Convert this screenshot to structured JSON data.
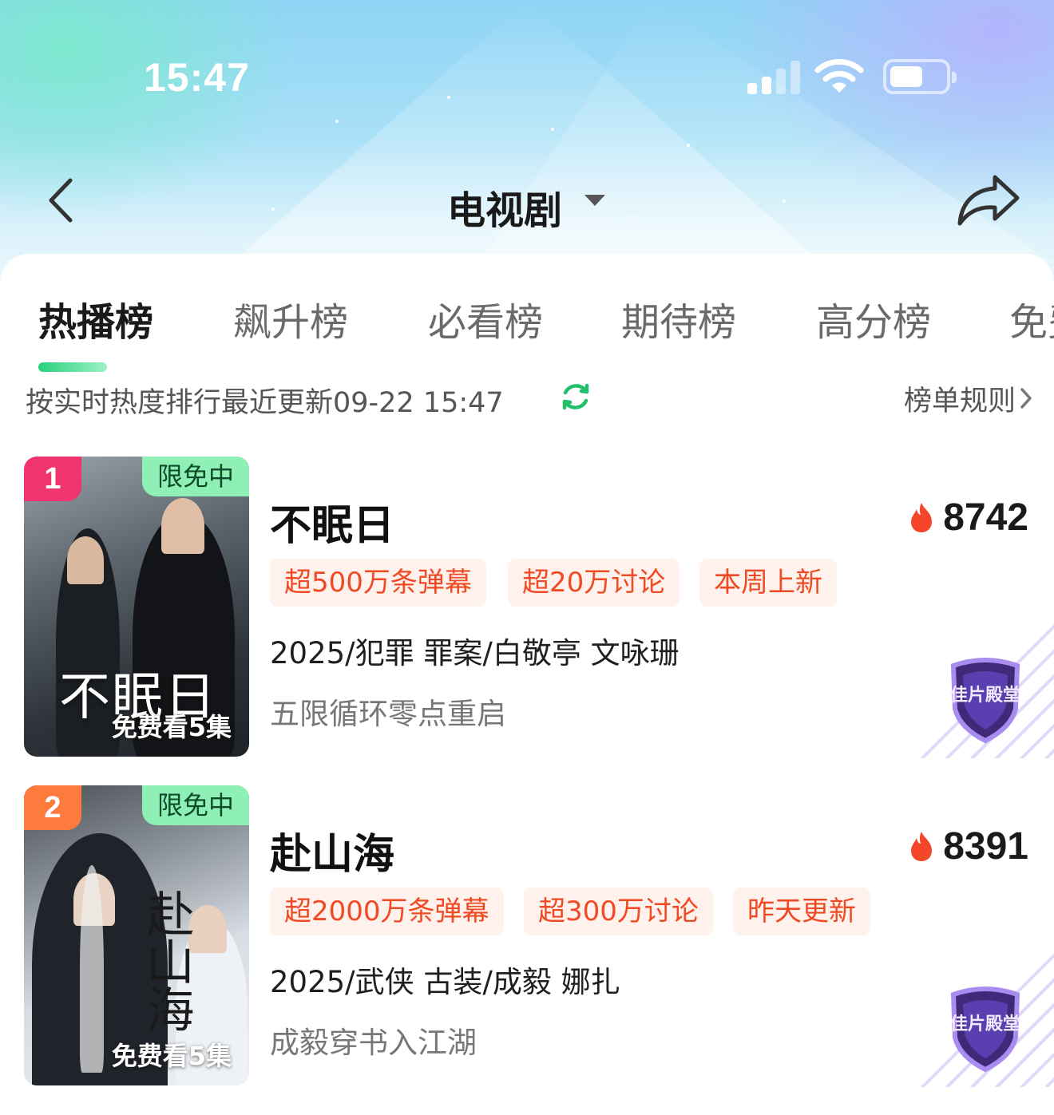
{
  "status_bar": {
    "time": "15:47"
  },
  "header": {
    "title": "电视剧"
  },
  "tabs": [
    "热播榜",
    "飙升榜",
    "必看榜",
    "期待榜",
    "高分榜",
    "免费"
  ],
  "active_tab": "热播榜",
  "info_bar": {
    "text": "按实时热度排行最近更新09-22 15:47",
    "rules_label": "榜单规则"
  },
  "items": [
    {
      "rank": "1",
      "free_badge": "限免中",
      "poster_title": "不眠日",
      "poster_free": "免费看5集",
      "title": "不眠日",
      "heat": "8742",
      "tags": [
        "超500万条弹幕",
        "超20万讨论",
        "本周上新"
      ],
      "meta": "2025/犯罪 罪案/白敬亭 文咏珊",
      "desc": "五限循环零点重启",
      "hall_badge": "佳片殿堂"
    },
    {
      "rank": "2",
      "free_badge": "限免中",
      "poster_title": "赴山海",
      "poster_free": "免费看5集",
      "title": "赴山海",
      "heat": "8391",
      "tags": [
        "超2000万条弹幕",
        "超300万讨论",
        "昨天更新"
      ],
      "meta": "2025/武侠 古装/成毅 娜扎",
      "desc": "成毅穿书入江湖",
      "hall_badge": "佳片殿堂"
    }
  ],
  "colors": {
    "accent_green": "#28d17c",
    "tag_text": "#f04a24",
    "tag_bg": "#fff1ec",
    "rank1": "#f0356e",
    "rank2": "#ff7a3d"
  }
}
